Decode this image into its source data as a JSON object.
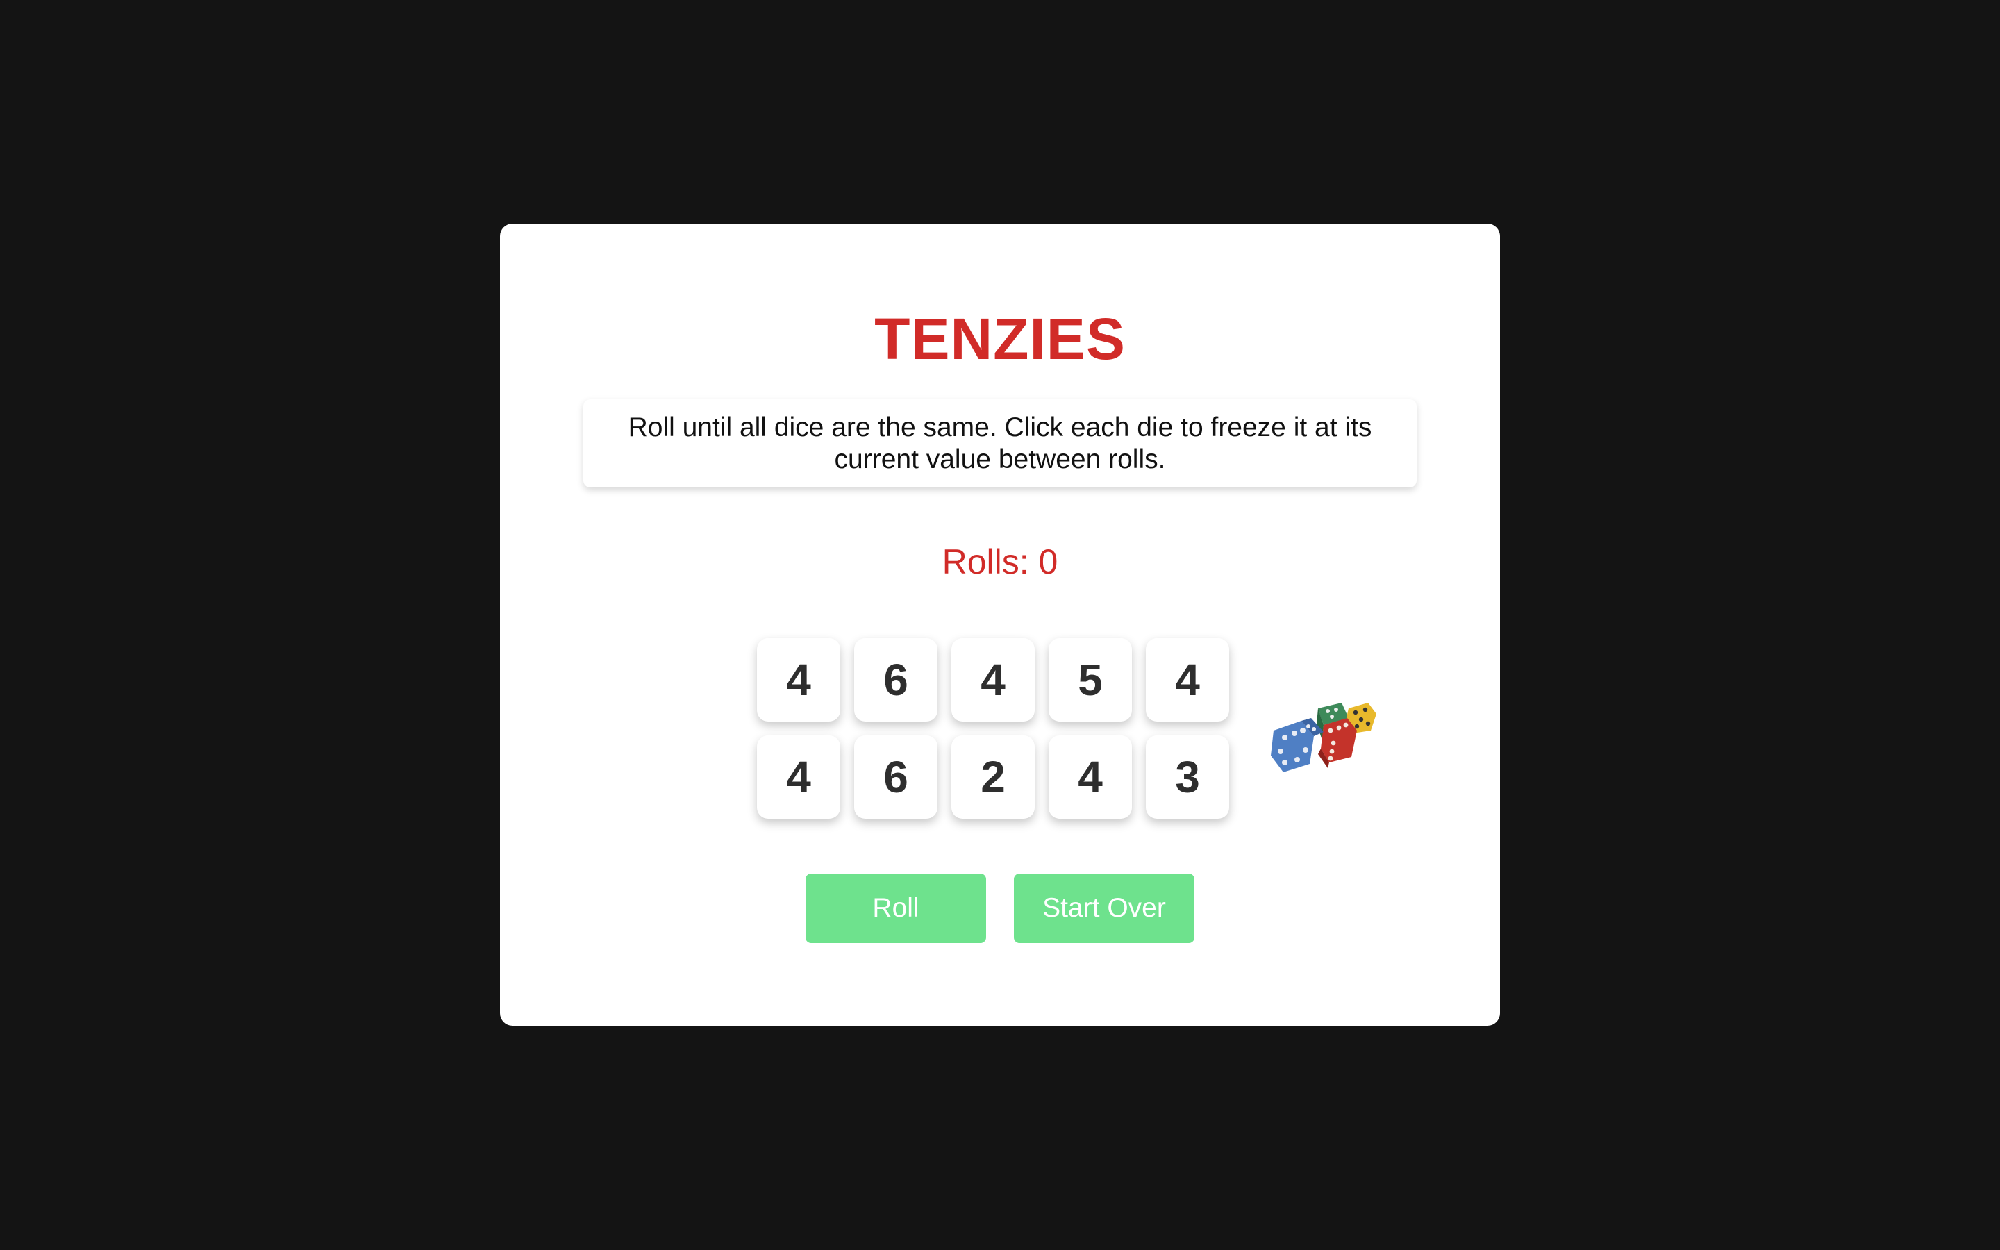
{
  "game": {
    "title": "TENZIES",
    "instructions": "Roll until all dice are the same. Click each die to freeze it at its current value between rolls.",
    "rolls_text": "Rolls: 0",
    "dice": [
      "4",
      "6",
      "4",
      "5",
      "4",
      "4",
      "6",
      "2",
      "4",
      "3"
    ],
    "buttons": {
      "roll_label": "Roll",
      "start_over_label": "Start Over"
    }
  },
  "colors": {
    "background": "#141414",
    "accent_red": "#d12b28",
    "button_green": "#6ee28d"
  },
  "icons": {
    "dice_illustration": "colorful-dice-icon"
  }
}
